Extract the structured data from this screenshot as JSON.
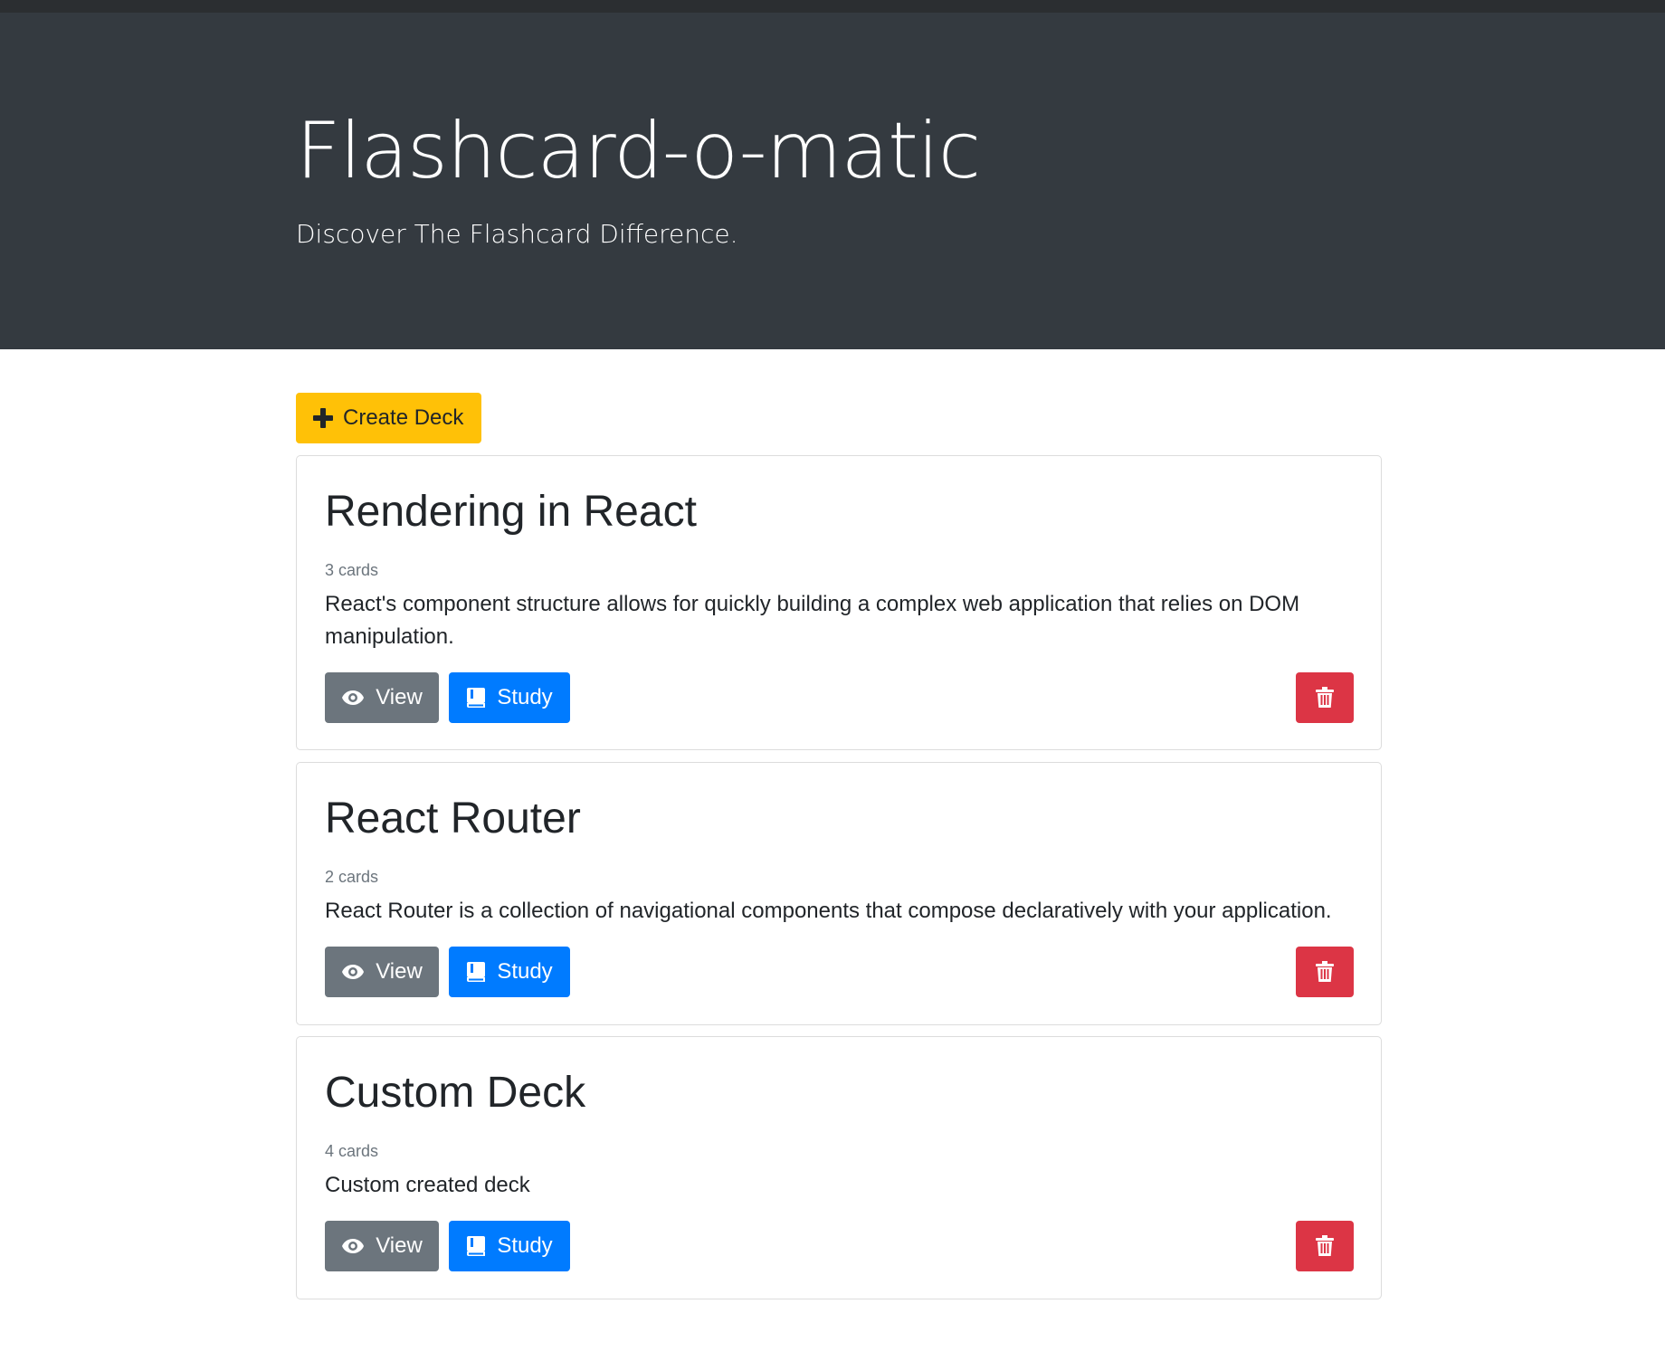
{
  "header": {
    "title": "Flashcard-o-matic",
    "subtitle": "Discover The Flashcard Difference."
  },
  "actions": {
    "create_deck_label": "Create Deck"
  },
  "decks": [
    {
      "title": "Rendering in React",
      "count": "3 cards",
      "description": "React's component structure allows for quickly building a complex web application that relies on DOM manipulation.",
      "view_label": "View",
      "study_label": "Study"
    },
    {
      "title": "React Router",
      "count": "2 cards",
      "description": "React Router is a collection of navigational components that compose declaratively with your application.",
      "view_label": "View",
      "study_label": "Study"
    },
    {
      "title": "Custom Deck",
      "count": "4 cards",
      "description": "Custom created deck",
      "view_label": "View",
      "study_label": "Study"
    }
  ],
  "colors": {
    "header_bg": "#343a40",
    "create_button": "#ffc107",
    "view_button": "#6c757d",
    "study_button": "#007bff",
    "delete_button": "#dc3545"
  },
  "icons": {
    "create": "plus-icon",
    "view": "eye-icon",
    "study": "book-icon",
    "delete": "trash-icon"
  }
}
